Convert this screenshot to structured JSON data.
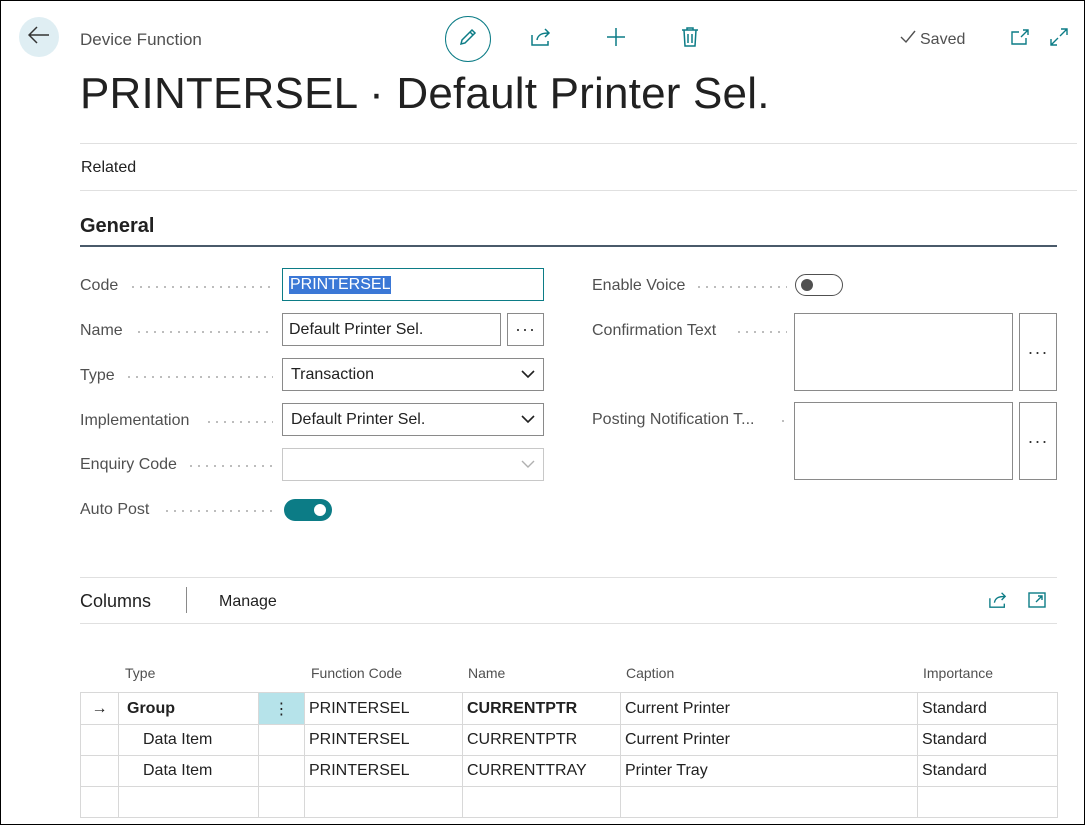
{
  "header": {
    "breadcrumb": "Device Function",
    "title": "PRINTERSEL · Default Printer Sel.",
    "status": "Saved"
  },
  "nav": {
    "related": "Related"
  },
  "general": {
    "section_title": "General",
    "code_label": "Code",
    "code_value": "PRINTERSEL",
    "name_label": "Name",
    "name_value": "Default Printer Sel.",
    "type_label": "Type",
    "type_value": "Transaction",
    "implementation_label": "Implementation",
    "implementation_value": "Default Printer Sel.",
    "enquiry_code_label": "Enquiry Code",
    "enquiry_code_value": "",
    "auto_post_label": "Auto Post",
    "auto_post_value": true,
    "enable_voice_label": "Enable Voice",
    "enable_voice_value": false,
    "confirmation_text_label": "Confirmation Text",
    "posting_notification_label": "Posting Notification T...",
    "ellipsis": "···"
  },
  "columns_part": {
    "title": "Columns",
    "manage": "Manage",
    "headers": [
      "Type",
      "Function Code",
      "Name",
      "Caption",
      "Importance"
    ],
    "rows": [
      {
        "indicator": "→",
        "type": "Group",
        "function_code": "PRINTERSEL",
        "name": "CURRENTPTR",
        "caption": "Current Printer",
        "importance": "Standard",
        "menu": "⋮"
      },
      {
        "indicator": "",
        "type": "Data Item",
        "function_code": "PRINTERSEL",
        "name": "CURRENTPTR",
        "caption": "Current Printer",
        "importance": "Standard",
        "menu": ""
      },
      {
        "indicator": "",
        "type": "Data Item",
        "function_code": "PRINTERSEL",
        "name": "CURRENTTRAY",
        "caption": "Printer Tray",
        "importance": "Standard",
        "menu": ""
      },
      {
        "indicator": "",
        "type": "",
        "function_code": "",
        "name": "",
        "caption": "",
        "importance": "",
        "menu": ""
      }
    ]
  },
  "colors": {
    "accent": "#0c7c86",
    "selection": "#3b78d6",
    "back_bg": "#dfeef3",
    "row_highlight": "#b6e3ea"
  }
}
